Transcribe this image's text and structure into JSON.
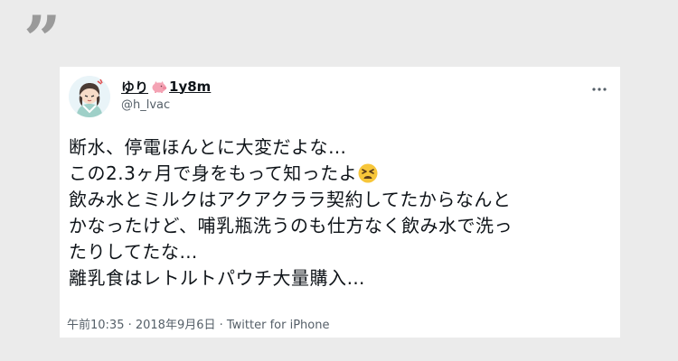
{
  "quote_glyph": "”",
  "tweet": {
    "display_name": "ゆり",
    "time": "1y8m",
    "handle": "@h_lvac",
    "lines": [
      "断水、停電ほんとに大変だよな…",
      "この2.3ヶ月で身をもって知ったよ",
      "飲み水とミルクはアクアクララ契約してたからなんと",
      "かなったけど、哺乳瓶洗うのも仕方なく飲み水で洗っ",
      "たりしてたな…",
      "離乳食はレトルトパウチ大量購入…"
    ],
    "emoji_icon": "tired-face-emoji",
    "footer": "午前10:35 · 2018年9月6日 · Twitter for iPhone"
  },
  "icons": {
    "name_badge": "pig-icon",
    "menu": "more-horizontal-icon"
  },
  "colors": {
    "page_background": "#ebebeb",
    "card_background": "#ffffff",
    "quote_mark": "#9a9a9a",
    "text_primary": "#0f1419",
    "text_secondary": "#555f68",
    "pig": "#f4a3b4",
    "emoji": "#f7c63a"
  }
}
